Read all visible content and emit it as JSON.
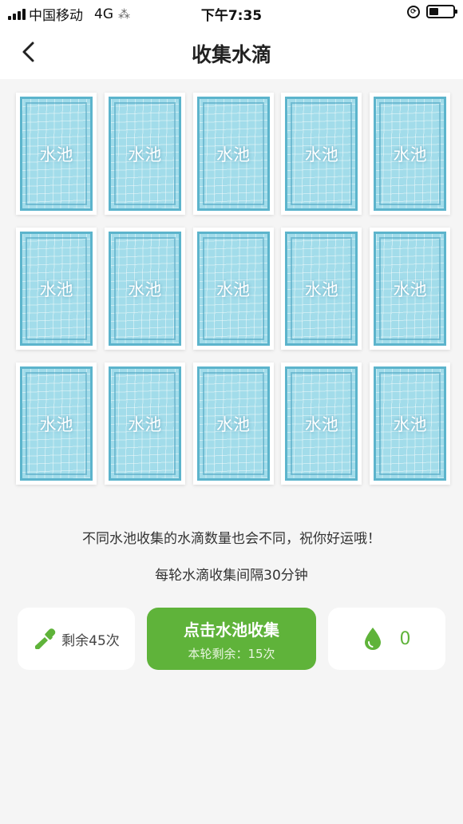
{
  "status_bar": {
    "carrier": "中国移动",
    "network": "4G",
    "time": "下午7:35",
    "loading_glyph": "⁂"
  },
  "header": {
    "title": "收集水滴",
    "back_icon": "chevron-left-icon"
  },
  "pools": [
    {
      "label": "水池"
    },
    {
      "label": "水池"
    },
    {
      "label": "水池"
    },
    {
      "label": "水池"
    },
    {
      "label": "水池"
    },
    {
      "label": "水池"
    },
    {
      "label": "水池"
    },
    {
      "label": "水池"
    },
    {
      "label": "水池"
    },
    {
      "label": "水池"
    },
    {
      "label": "水池"
    },
    {
      "label": "水池"
    },
    {
      "label": "水池"
    },
    {
      "label": "水池"
    },
    {
      "label": "水池"
    }
  ],
  "tips": {
    "line1": "不同水池收集的水滴数量也会不同，祝你好运哦！",
    "line2": "每轮水滴收集间隔30分钟"
  },
  "actions": {
    "remaining_label": "剩余45次",
    "remaining_icon": "dropper-icon",
    "collect_title": "点击水池收集",
    "collect_sub": "本轮剩余：15次",
    "drop_count": "0",
    "drop_icon": "water-drop-icon"
  },
  "colors": {
    "accent_green": "#5fb33a",
    "pool_water": "#a2dcea",
    "pool_border": "#5cb4cc"
  }
}
